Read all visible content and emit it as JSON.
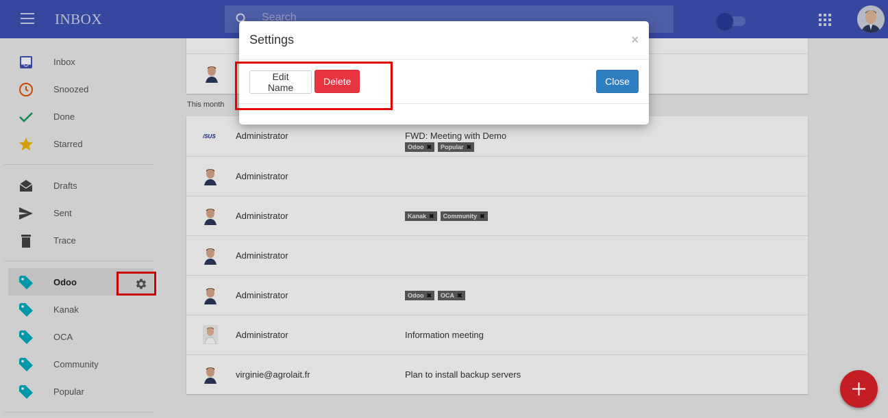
{
  "header": {
    "title": "INBOX",
    "search_placeholder": "Search",
    "icons": [
      "menu-icon",
      "search-icon",
      "toggle-switch",
      "apps-grid-icon",
      "user-avatar"
    ]
  },
  "sidebar": {
    "items": [
      {
        "label": "Inbox",
        "icon": "inbox-icon",
        "color": "#3f51b5"
      },
      {
        "label": "Snoozed",
        "icon": "clock-icon",
        "color": "#e65100"
      },
      {
        "label": "Done",
        "icon": "check-icon",
        "color": "#0f9d58"
      },
      {
        "label": "Starred",
        "icon": "star-icon",
        "color": "#f4b400"
      },
      {
        "label": "Drafts",
        "icon": "drafts-icon",
        "color": "#444444"
      },
      {
        "label": "Sent",
        "icon": "send-icon",
        "color": "#444444"
      },
      {
        "label": "Trace",
        "icon": "trash-icon",
        "color": "#444444"
      }
    ],
    "tags": [
      {
        "label": "Odoo",
        "active": true
      },
      {
        "label": "Kanak"
      },
      {
        "label": "OCA"
      },
      {
        "label": "Community"
      },
      {
        "label": "Popular"
      }
    ],
    "tag_color": "#00acc1"
  },
  "content": {
    "section_label": "This month",
    "rows": [
      {
        "sender": "Administrator",
        "subject": "FWD: Meeting with Demo",
        "tags": [
          "Odoo",
          "Popular"
        ],
        "avatar": "asus-logo"
      },
      {
        "sender": "Administrator",
        "subject": "",
        "tags": []
      },
      {
        "sender": "Administrator",
        "subject": "",
        "tags": [
          "Kanak",
          "Community"
        ]
      },
      {
        "sender": "Administrator",
        "subject": "",
        "tags": []
      },
      {
        "sender": "Administrator",
        "subject": "",
        "tags": [
          "Odoo",
          "OCA"
        ]
      },
      {
        "sender": "Administrator",
        "subject": "Information meeting",
        "tags": []
      },
      {
        "sender": "virginie@agrolait.fr",
        "subject": "Plan to install backup servers",
        "tags": []
      }
    ]
  },
  "modal": {
    "title": "Settings",
    "close_x": "×",
    "edit_label": "Edit Name",
    "delete_label": "Delete",
    "close_label": "Close"
  },
  "colors": {
    "header": "#3f51b5",
    "delete": "#e8343f",
    "close": "#2f7ec0",
    "fab": "#c41e24",
    "highlight": "#e50000"
  }
}
